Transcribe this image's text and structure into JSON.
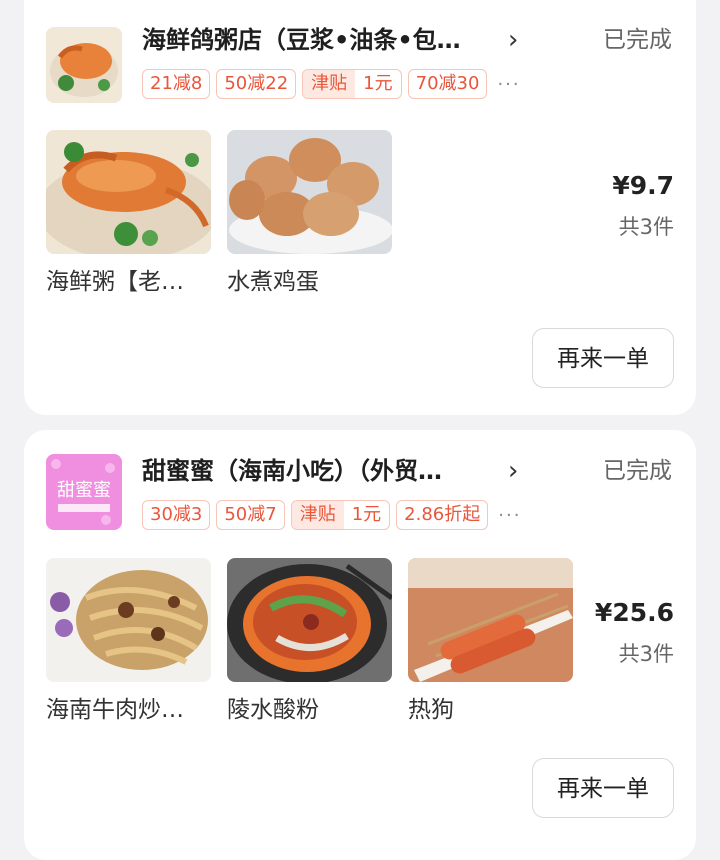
{
  "orders": [
    {
      "shop_name": "海鲜鸽粥店（豆浆•油条•包…",
      "status": "已完成",
      "tags": [
        "21减8",
        "50减22"
      ],
      "subsidy": {
        "label": "津贴",
        "value": "1元"
      },
      "tag_last": "70减30",
      "more": "···",
      "items": [
        {
          "name": "海鲜粥【老…",
          "image": "crab-congee"
        },
        {
          "name": "水煮鸡蛋",
          "image": "boiled-eggs"
        }
      ],
      "price": "¥9.7",
      "count": "共3件",
      "reorder_label": "再来一单"
    },
    {
      "shop_name": "甜蜜蜜（海南小吃）（外贸…",
      "status": "已完成",
      "tags": [
        "30减3",
        "50减7"
      ],
      "subsidy": {
        "label": "津贴",
        "value": "1元"
      },
      "tag_last": "2.86折起",
      "more": "···",
      "logo_text": "甜蜜蜜",
      "items": [
        {
          "name": "海南牛肉炒…",
          "image": "beef-noodles"
        },
        {
          "name": "陵水酸粉",
          "image": "sour-rice-noodles"
        },
        {
          "name": "热狗",
          "image": "hot-dog"
        }
      ],
      "price": "¥25.6",
      "count": "共3件",
      "reorder_label": "再来一单"
    }
  ],
  "icons": {
    "chevron": "chevron-right-icon"
  },
  "colors": {
    "tag_red": "#e9563b",
    "card_bg": "#ffffff",
    "page_bg": "#f2f2f4"
  }
}
